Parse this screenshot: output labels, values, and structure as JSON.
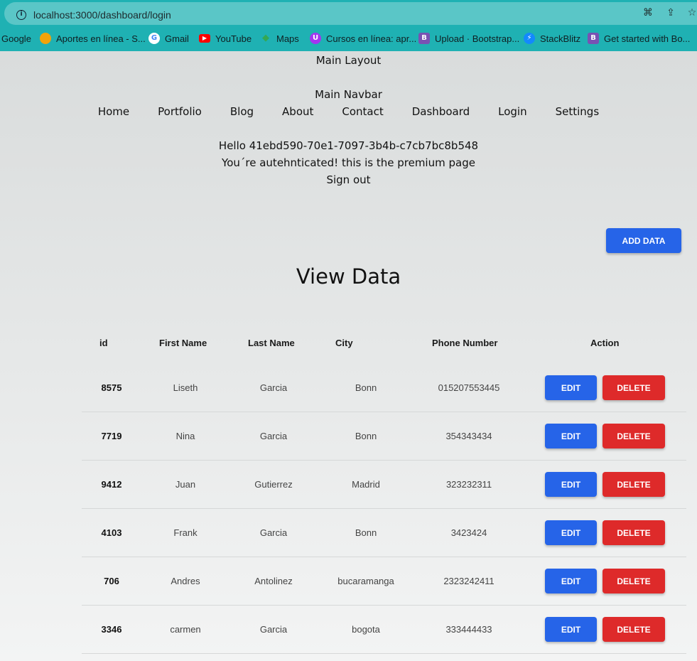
{
  "browser": {
    "url": "localhost:3000/dashboard/login",
    "bookmarks": [
      {
        "label": "Google",
        "icon": "google-text",
        "color": ""
      },
      {
        "label": "Aportes en línea - S...",
        "icon": "aportes-icon",
        "color": "#f0a30a"
      },
      {
        "label": "Gmail",
        "icon": "google-g-icon",
        "color": "#ffffff"
      },
      {
        "label": "YouTube",
        "icon": "youtube-icon",
        "color": "#ff0000"
      },
      {
        "label": "Maps",
        "icon": "maps-icon",
        "color": "#34a853"
      },
      {
        "label": "Cursos en línea: apr...",
        "icon": "udemy-icon",
        "color": "#a435f0"
      },
      {
        "label": "Upload · Bootstrap...",
        "icon": "bootstrap-icon",
        "color": "#7952b3"
      },
      {
        "label": "StackBlitz",
        "icon": "stackblitz-icon",
        "color": "#1389fd"
      },
      {
        "label": "Get started with Bo...",
        "icon": "bootstrap-icon",
        "color": "#7952b3"
      }
    ]
  },
  "layout": {
    "main_layout": "Main Layout",
    "main_navbar": "Main Navbar"
  },
  "nav": [
    "Home",
    "Portfolio",
    "Blog",
    "About",
    "Contact",
    "Dashboard",
    "Login",
    "Settings"
  ],
  "auth": {
    "hello": "Hello 41ebd590-70e1-7097-3b4b-c7cb7bc8b548",
    "message": "You´re autehnticated! this is the premium page",
    "sign_out": "Sign out"
  },
  "actions": {
    "add_data": "ADD DATA",
    "edit": "EDIT",
    "delete": "DELETE"
  },
  "view_title": "View Data",
  "table": {
    "headers": [
      "id",
      "First Name",
      "Last Name",
      "City",
      "Phone Number",
      "Action"
    ],
    "rows": [
      {
        "id": "8575",
        "first": "Liseth",
        "last": "Garcia",
        "city": "Bonn",
        "phone": "015207553445"
      },
      {
        "id": "7719",
        "first": "Nina",
        "last": "Garcia",
        "city": "Bonn",
        "phone": "354343434"
      },
      {
        "id": "9412",
        "first": "Juan",
        "last": "Gutierrez",
        "city": "Madrid",
        "phone": "323232311"
      },
      {
        "id": "4103",
        "first": "Frank",
        "last": "Garcia",
        "city": "Bonn",
        "phone": "3423424"
      },
      {
        "id": "706",
        "first": "Andres",
        "last": "Antolinez",
        "city": "bucaramanga",
        "phone": "2323242411"
      },
      {
        "id": "3346",
        "first": "carmen",
        "last": "Garcia",
        "city": "bogota",
        "phone": "333444433"
      }
    ]
  },
  "colors": {
    "browser_bar": "#1fb1b3",
    "primary": "#2664e8",
    "danger": "#de2a2a"
  }
}
